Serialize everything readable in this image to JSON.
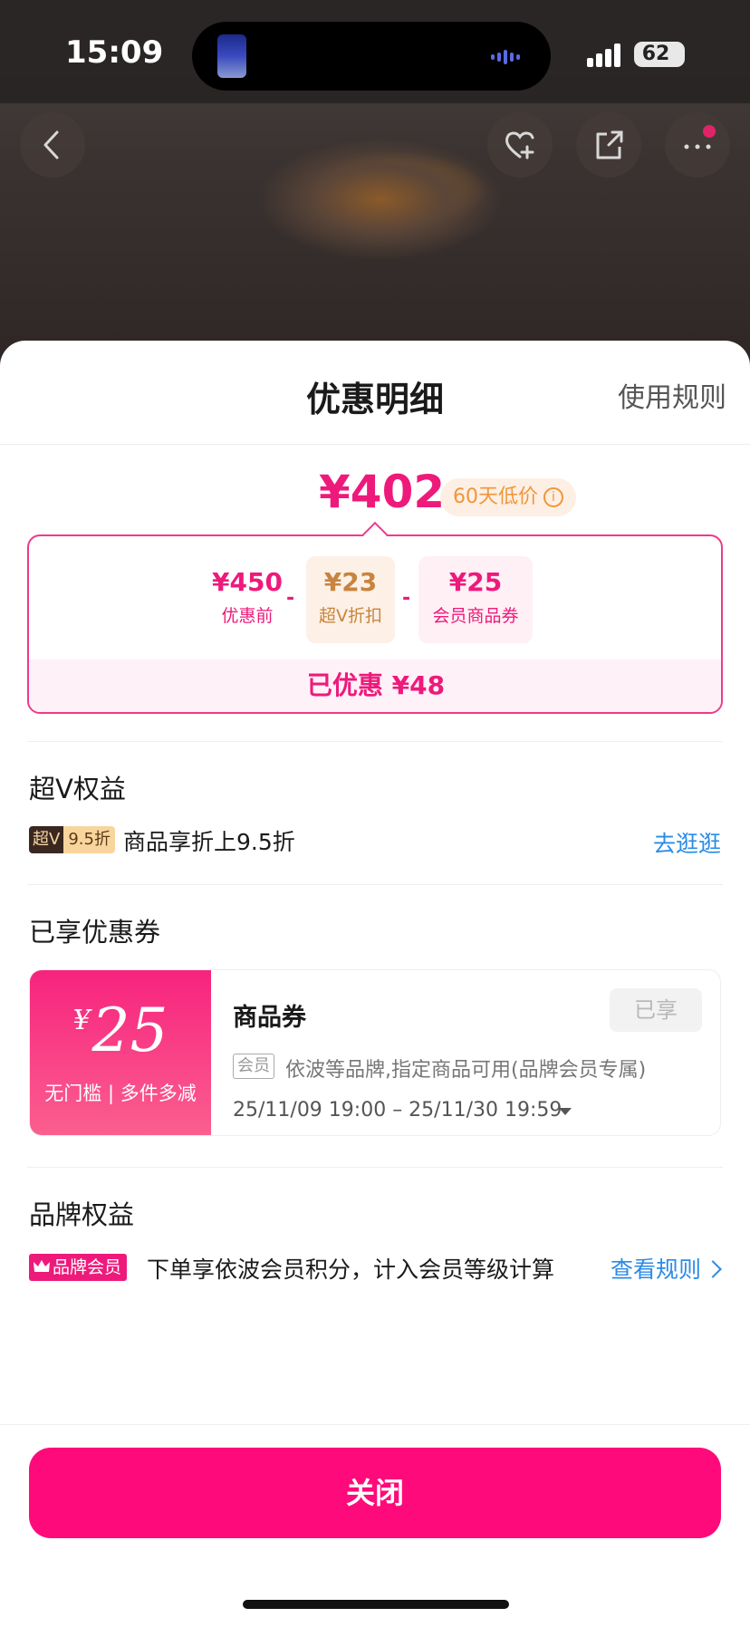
{
  "status_bar": {
    "time": "15:09",
    "battery": "62"
  },
  "sheet": {
    "title": "优惠明细",
    "rules_link": "使用规则"
  },
  "price": {
    "final": "¥402",
    "low_badge": "60天低价",
    "info_glyph": "i",
    "calc": {
      "original_amount": "¥450",
      "original_label": "优惠前",
      "minus": "-",
      "svip_amount": "¥23",
      "svip_label": "超V折扣",
      "coupon_amount": "¥25",
      "coupon_label": "会员商品券",
      "saved": "已优惠 ¥48"
    }
  },
  "svip_section": {
    "title": "超V权益",
    "tag_a": "超V",
    "tag_b": "9.5折",
    "desc": "商品享折上9.5折",
    "link": "去逛逛"
  },
  "coupon_section": {
    "title": "已享优惠券",
    "coupon": {
      "yen": "¥",
      "amount": "25",
      "condition": "无门槛 | 多件多减",
      "name": "商品券",
      "status": "已享",
      "member_tag": "会员",
      "desc": "依波等品牌,指定商品可用(品牌会员专属)",
      "date_range": "25/11/09 19:00 – 25/11/30 19:59"
    }
  },
  "brand_section": {
    "title": "品牌权益",
    "tag": "品牌会员",
    "desc": "下单享依波会员积分，计入会员等级计算",
    "link": "查看规则"
  },
  "footer": {
    "close_label": "关闭"
  },
  "colors": {
    "accent": "#ee1a7b",
    "button": "#ff0a7a",
    "link": "#2a8be8",
    "badge_orange": "#f0963a"
  },
  "icons": [
    "back-icon",
    "heart-plus-icon",
    "share-icon",
    "more-icon",
    "info-icon",
    "crown-icon",
    "chevron-right-icon",
    "caret-down-icon"
  ]
}
